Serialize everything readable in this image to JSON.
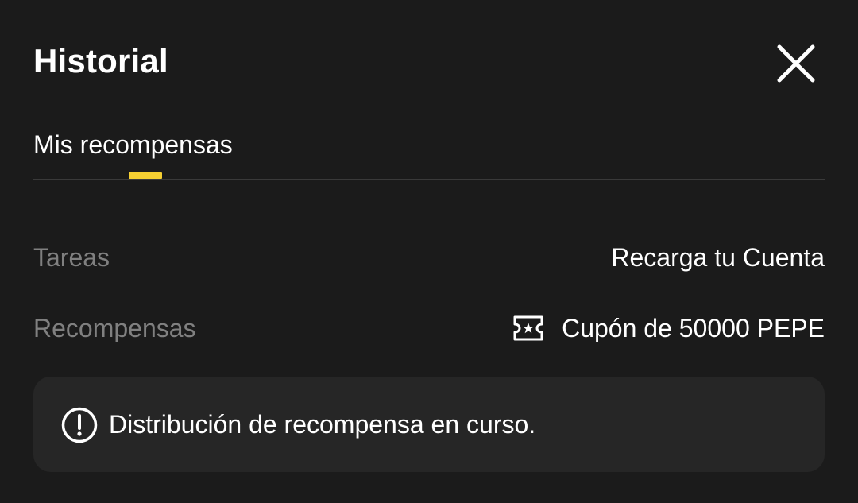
{
  "header": {
    "title": "Historial"
  },
  "tabs": [
    {
      "label": "Mis recompensas",
      "active": true
    }
  ],
  "details": {
    "tasks_label": "Tareas",
    "tasks_value": "Recarga tu Cuenta",
    "rewards_label": "Recompensas",
    "rewards_value": "Cupón de 50000 PEPE"
  },
  "notice": {
    "text": "Distribución de recompensa en curso."
  },
  "icons": {
    "close": "close-icon",
    "coupon": "ticket-icon",
    "notice": "exclamation-circle-icon"
  },
  "colors": {
    "background": "#1b1b1b",
    "accent": "#f5cf32",
    "muted_text": "#808080",
    "notice_background": "#262626"
  }
}
